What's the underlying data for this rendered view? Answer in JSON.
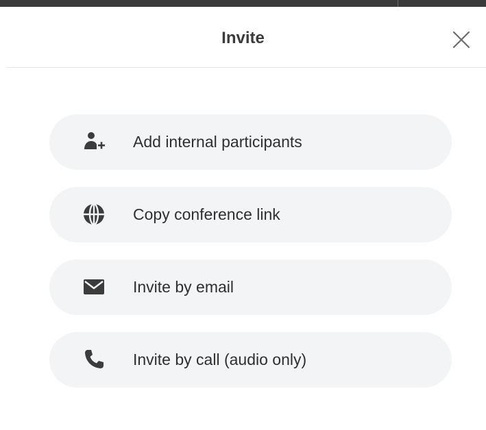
{
  "dialog": {
    "title": "Invite",
    "close_icon": "close-icon"
  },
  "options": [
    {
      "label": "Add internal participants",
      "icon": "add-person-icon"
    },
    {
      "label": "Copy conference link",
      "icon": "globe-icon"
    },
    {
      "label": "Invite by email",
      "icon": "envelope-icon"
    },
    {
      "label": "Invite by call (audio only)",
      "icon": "phone-icon"
    }
  ],
  "colors": {
    "text": "#2f2f2f",
    "icon": "#3c3c3c",
    "option_background": "#f3f4f5",
    "top_bar": "#3a3a3a"
  }
}
